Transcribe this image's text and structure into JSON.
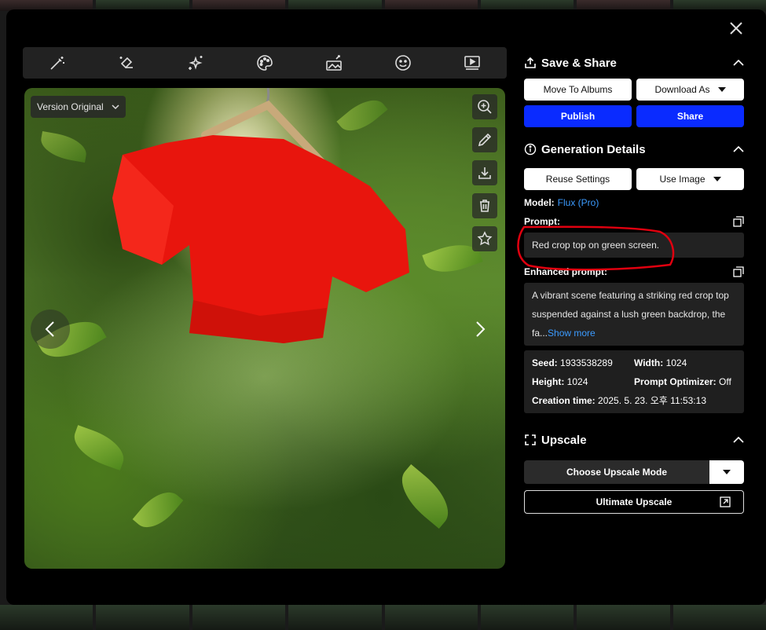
{
  "toolbar": {
    "icons": [
      "magic-wand-icon",
      "eraser-icon",
      "sparkle-icon",
      "palette-icon",
      "image-edit-icon",
      "face-icon",
      "video-icon"
    ]
  },
  "image": {
    "version_label": "Version Original"
  },
  "save_share": {
    "title": "Save & Share",
    "move_to_albums": "Move To Albums",
    "download_as": "Download As",
    "publish": "Publish",
    "share": "Share"
  },
  "generation": {
    "title": "Generation Details",
    "reuse_settings": "Reuse Settings",
    "use_image": "Use Image",
    "model_label": "Model:",
    "model_value": "Flux (Pro)",
    "prompt_label": "Prompt:",
    "prompt_text": "Red crop top on green screen.",
    "enhanced_label": "Enhanced prompt:",
    "enhanced_text": "A vibrant scene featuring a striking red crop top suspended against a lush green backdrop, the fa...",
    "show_more": "Show more",
    "seed_label": "Seed:",
    "seed_value": "1933538289",
    "width_label": "Width:",
    "width_value": "1024",
    "height_label": "Height:",
    "height_value": "1024",
    "optimizer_label": "Prompt Optimizer:",
    "optimizer_value": "Off",
    "creation_label": "Creation time:",
    "creation_value": "2025. 5. 23. 오후 11:53:13"
  },
  "upscale": {
    "title": "Upscale",
    "mode_label": "Choose Upscale Mode",
    "ultimate_label": "Ultimate Upscale"
  },
  "colors": {
    "accent_blue": "#0a2bff",
    "link_blue": "#3b9bff",
    "annotation_red": "#e0000f"
  }
}
